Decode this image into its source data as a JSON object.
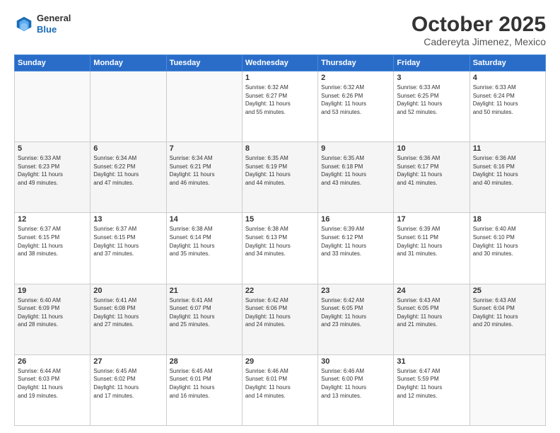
{
  "header": {
    "logo": {
      "general": "General",
      "blue": "Blue"
    },
    "month": "October 2025",
    "location": "Cadereyta Jimenez, Mexico"
  },
  "weekdays": [
    "Sunday",
    "Monday",
    "Tuesday",
    "Wednesday",
    "Thursday",
    "Friday",
    "Saturday"
  ],
  "weeks": [
    [
      {
        "day": "",
        "info": ""
      },
      {
        "day": "",
        "info": ""
      },
      {
        "day": "",
        "info": ""
      },
      {
        "day": "1",
        "info": "Sunrise: 6:32 AM\nSunset: 6:27 PM\nDaylight: 11 hours\nand 55 minutes."
      },
      {
        "day": "2",
        "info": "Sunrise: 6:32 AM\nSunset: 6:26 PM\nDaylight: 11 hours\nand 53 minutes."
      },
      {
        "day": "3",
        "info": "Sunrise: 6:33 AM\nSunset: 6:25 PM\nDaylight: 11 hours\nand 52 minutes."
      },
      {
        "day": "4",
        "info": "Sunrise: 6:33 AM\nSunset: 6:24 PM\nDaylight: 11 hours\nand 50 minutes."
      }
    ],
    [
      {
        "day": "5",
        "info": "Sunrise: 6:33 AM\nSunset: 6:23 PM\nDaylight: 11 hours\nand 49 minutes."
      },
      {
        "day": "6",
        "info": "Sunrise: 6:34 AM\nSunset: 6:22 PM\nDaylight: 11 hours\nand 47 minutes."
      },
      {
        "day": "7",
        "info": "Sunrise: 6:34 AM\nSunset: 6:21 PM\nDaylight: 11 hours\nand 46 minutes."
      },
      {
        "day": "8",
        "info": "Sunrise: 6:35 AM\nSunset: 6:19 PM\nDaylight: 11 hours\nand 44 minutes."
      },
      {
        "day": "9",
        "info": "Sunrise: 6:35 AM\nSunset: 6:18 PM\nDaylight: 11 hours\nand 43 minutes."
      },
      {
        "day": "10",
        "info": "Sunrise: 6:36 AM\nSunset: 6:17 PM\nDaylight: 11 hours\nand 41 minutes."
      },
      {
        "day": "11",
        "info": "Sunrise: 6:36 AM\nSunset: 6:16 PM\nDaylight: 11 hours\nand 40 minutes."
      }
    ],
    [
      {
        "day": "12",
        "info": "Sunrise: 6:37 AM\nSunset: 6:15 PM\nDaylight: 11 hours\nand 38 minutes."
      },
      {
        "day": "13",
        "info": "Sunrise: 6:37 AM\nSunset: 6:15 PM\nDaylight: 11 hours\nand 37 minutes."
      },
      {
        "day": "14",
        "info": "Sunrise: 6:38 AM\nSunset: 6:14 PM\nDaylight: 11 hours\nand 35 minutes."
      },
      {
        "day": "15",
        "info": "Sunrise: 6:38 AM\nSunset: 6:13 PM\nDaylight: 11 hours\nand 34 minutes."
      },
      {
        "day": "16",
        "info": "Sunrise: 6:39 AM\nSunset: 6:12 PM\nDaylight: 11 hours\nand 33 minutes."
      },
      {
        "day": "17",
        "info": "Sunrise: 6:39 AM\nSunset: 6:11 PM\nDaylight: 11 hours\nand 31 minutes."
      },
      {
        "day": "18",
        "info": "Sunrise: 6:40 AM\nSunset: 6:10 PM\nDaylight: 11 hours\nand 30 minutes."
      }
    ],
    [
      {
        "day": "19",
        "info": "Sunrise: 6:40 AM\nSunset: 6:09 PM\nDaylight: 11 hours\nand 28 minutes."
      },
      {
        "day": "20",
        "info": "Sunrise: 6:41 AM\nSunset: 6:08 PM\nDaylight: 11 hours\nand 27 minutes."
      },
      {
        "day": "21",
        "info": "Sunrise: 6:41 AM\nSunset: 6:07 PM\nDaylight: 11 hours\nand 25 minutes."
      },
      {
        "day": "22",
        "info": "Sunrise: 6:42 AM\nSunset: 6:06 PM\nDaylight: 11 hours\nand 24 minutes."
      },
      {
        "day": "23",
        "info": "Sunrise: 6:42 AM\nSunset: 6:05 PM\nDaylight: 11 hours\nand 23 minutes."
      },
      {
        "day": "24",
        "info": "Sunrise: 6:43 AM\nSunset: 6:05 PM\nDaylight: 11 hours\nand 21 minutes."
      },
      {
        "day": "25",
        "info": "Sunrise: 6:43 AM\nSunset: 6:04 PM\nDaylight: 11 hours\nand 20 minutes."
      }
    ],
    [
      {
        "day": "26",
        "info": "Sunrise: 6:44 AM\nSunset: 6:03 PM\nDaylight: 11 hours\nand 19 minutes."
      },
      {
        "day": "27",
        "info": "Sunrise: 6:45 AM\nSunset: 6:02 PM\nDaylight: 11 hours\nand 17 minutes."
      },
      {
        "day": "28",
        "info": "Sunrise: 6:45 AM\nSunset: 6:01 PM\nDaylight: 11 hours\nand 16 minutes."
      },
      {
        "day": "29",
        "info": "Sunrise: 6:46 AM\nSunset: 6:01 PM\nDaylight: 11 hours\nand 14 minutes."
      },
      {
        "day": "30",
        "info": "Sunrise: 6:46 AM\nSunset: 6:00 PM\nDaylight: 11 hours\nand 13 minutes."
      },
      {
        "day": "31",
        "info": "Sunrise: 6:47 AM\nSunset: 5:59 PM\nDaylight: 11 hours\nand 12 minutes."
      },
      {
        "day": "",
        "info": ""
      }
    ]
  ]
}
